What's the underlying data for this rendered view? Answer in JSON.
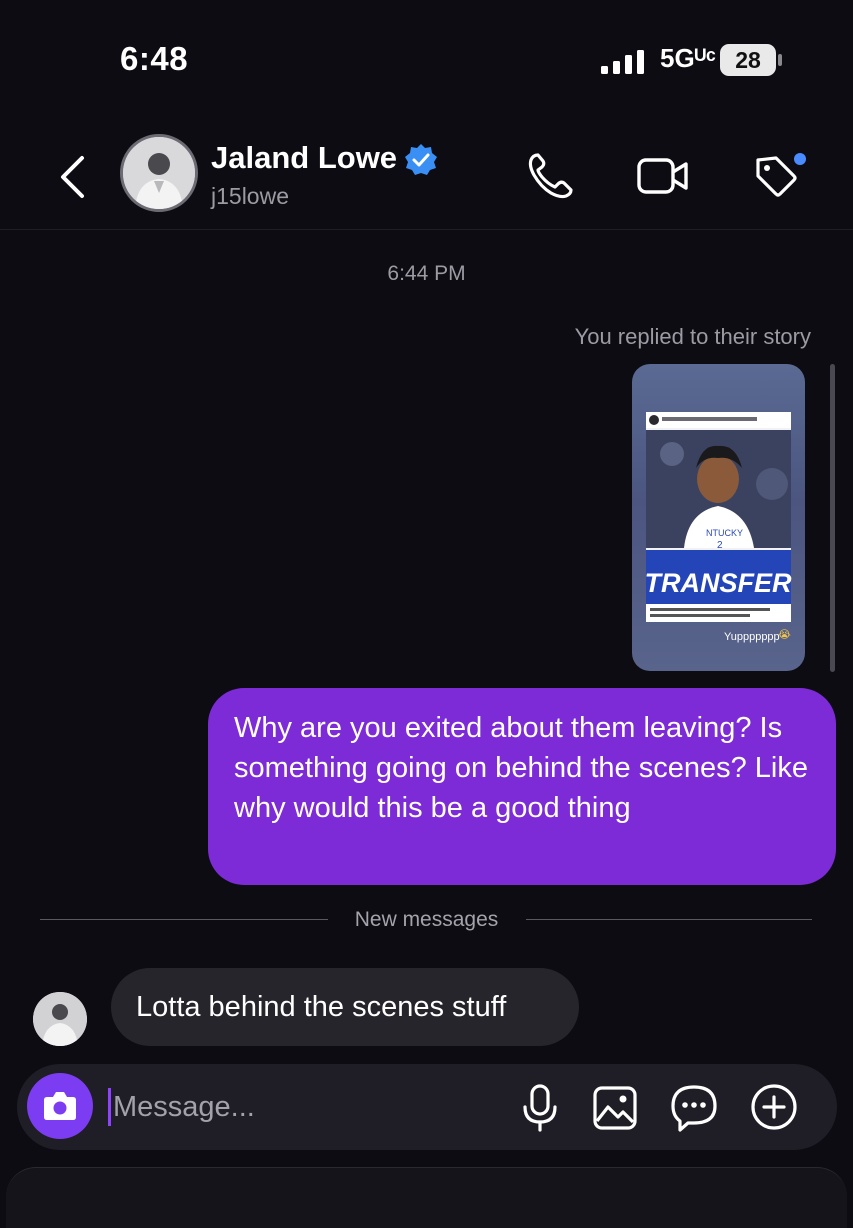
{
  "status_bar": {
    "time": "6:48",
    "network": "5Gᵁᶜ",
    "battery": "28"
  },
  "header": {
    "name": "Jaland Lowe",
    "username": "j15lowe",
    "icons": [
      "back-icon",
      "verified-icon",
      "phone-icon",
      "video-icon",
      "tag-icon"
    ],
    "verified_color": "#3a8ff5",
    "notification_dot_color": "#4a8cff"
  },
  "thread": {
    "timestamp": "6:44 PM",
    "reply_caption": "You replied to their story",
    "story": {
      "headline": "TRANSFER",
      "jersey_text": "NTUCKY",
      "jersey_number": "2",
      "reaction": "Yuppppppp",
      "reaction_emoji": "😭"
    },
    "sent_message": "Why are you exited about them leaving? Is something going on behind the scenes? Like why would this be a good thing",
    "divider_label": "New messages",
    "received_message": "Lotta behind the scenes stuff"
  },
  "composer": {
    "placeholder": "Message...",
    "icons": [
      "camera-icon",
      "mic-icon",
      "gallery-icon",
      "sticker-icon",
      "plus-icon"
    ]
  },
  "colors": {
    "background": "#0d0c12",
    "sent_bubble": "#7d2bd6",
    "received_bubble": "#26252c",
    "camera_button": "#7c3cf2"
  }
}
